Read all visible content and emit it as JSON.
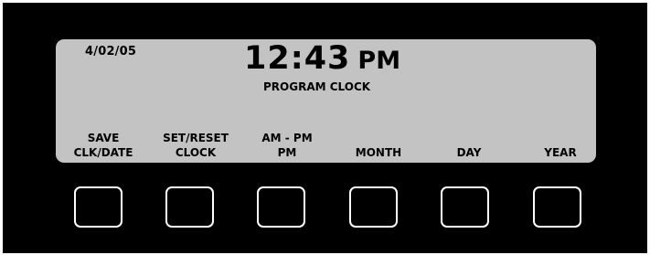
{
  "display": {
    "date": "4/02/05",
    "time": "12:43",
    "ampm": "PM",
    "mode": "PROGRAM CLOCK"
  },
  "softkeys": [
    {
      "line1": "SAVE",
      "line2": "CLK/DATE"
    },
    {
      "line1": "SET/RESET",
      "line2": "CLOCK"
    },
    {
      "line1": "AM - PM",
      "line2": "PM"
    },
    {
      "line1": "",
      "line2": "MONTH"
    },
    {
      "line1": "",
      "line2": "DAY"
    },
    {
      "line1": "",
      "line2": "YEAR"
    }
  ],
  "colors": {
    "bezel": "#000000",
    "lcd_background": "#c3c3c3",
    "lcd_text": "#000000",
    "button_outline": "#ffffff"
  }
}
